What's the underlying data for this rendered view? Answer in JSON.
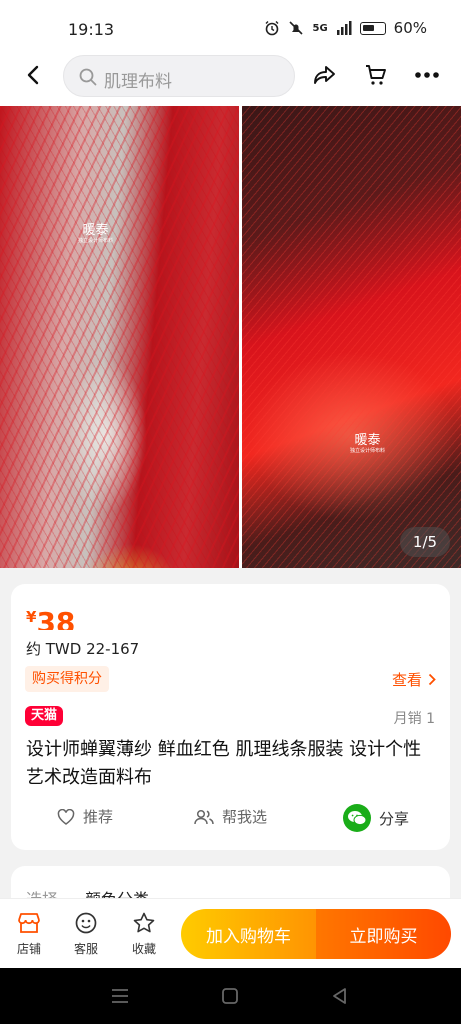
{
  "status_bar": {
    "time": "19:13",
    "network": "5G",
    "battery": "60%"
  },
  "header": {
    "search_placeholder": "肌理布料"
  },
  "gallery": {
    "counter": "1/5",
    "watermark_big": "暖泰",
    "watermark_small": "独立设计师布料"
  },
  "product": {
    "currency": "¥",
    "price": "38",
    "twd_price": "约 TWD 22-167",
    "points_label": "购买得积分",
    "view_label": "查看",
    "store_badge": "天猫",
    "sales": "月销 1",
    "title": "设计师蝉翼薄纱 鲜血红色 肌理线条服装 设计个性艺术改造面料布",
    "actions": {
      "recommend": "推荐",
      "help_choose": "帮我选",
      "share": "分享"
    }
  },
  "spec_card": {
    "label": "选择",
    "value": "颜色分类"
  },
  "bottom_bar": {
    "store": "店铺",
    "service": "客服",
    "favorite": "收藏",
    "add_cart": "加入购物车",
    "buy_now": "立即购买"
  },
  "colors": {
    "accent": "#ff5000",
    "tmall_red": "#ff0036",
    "wechat_green": "#1aad19"
  }
}
